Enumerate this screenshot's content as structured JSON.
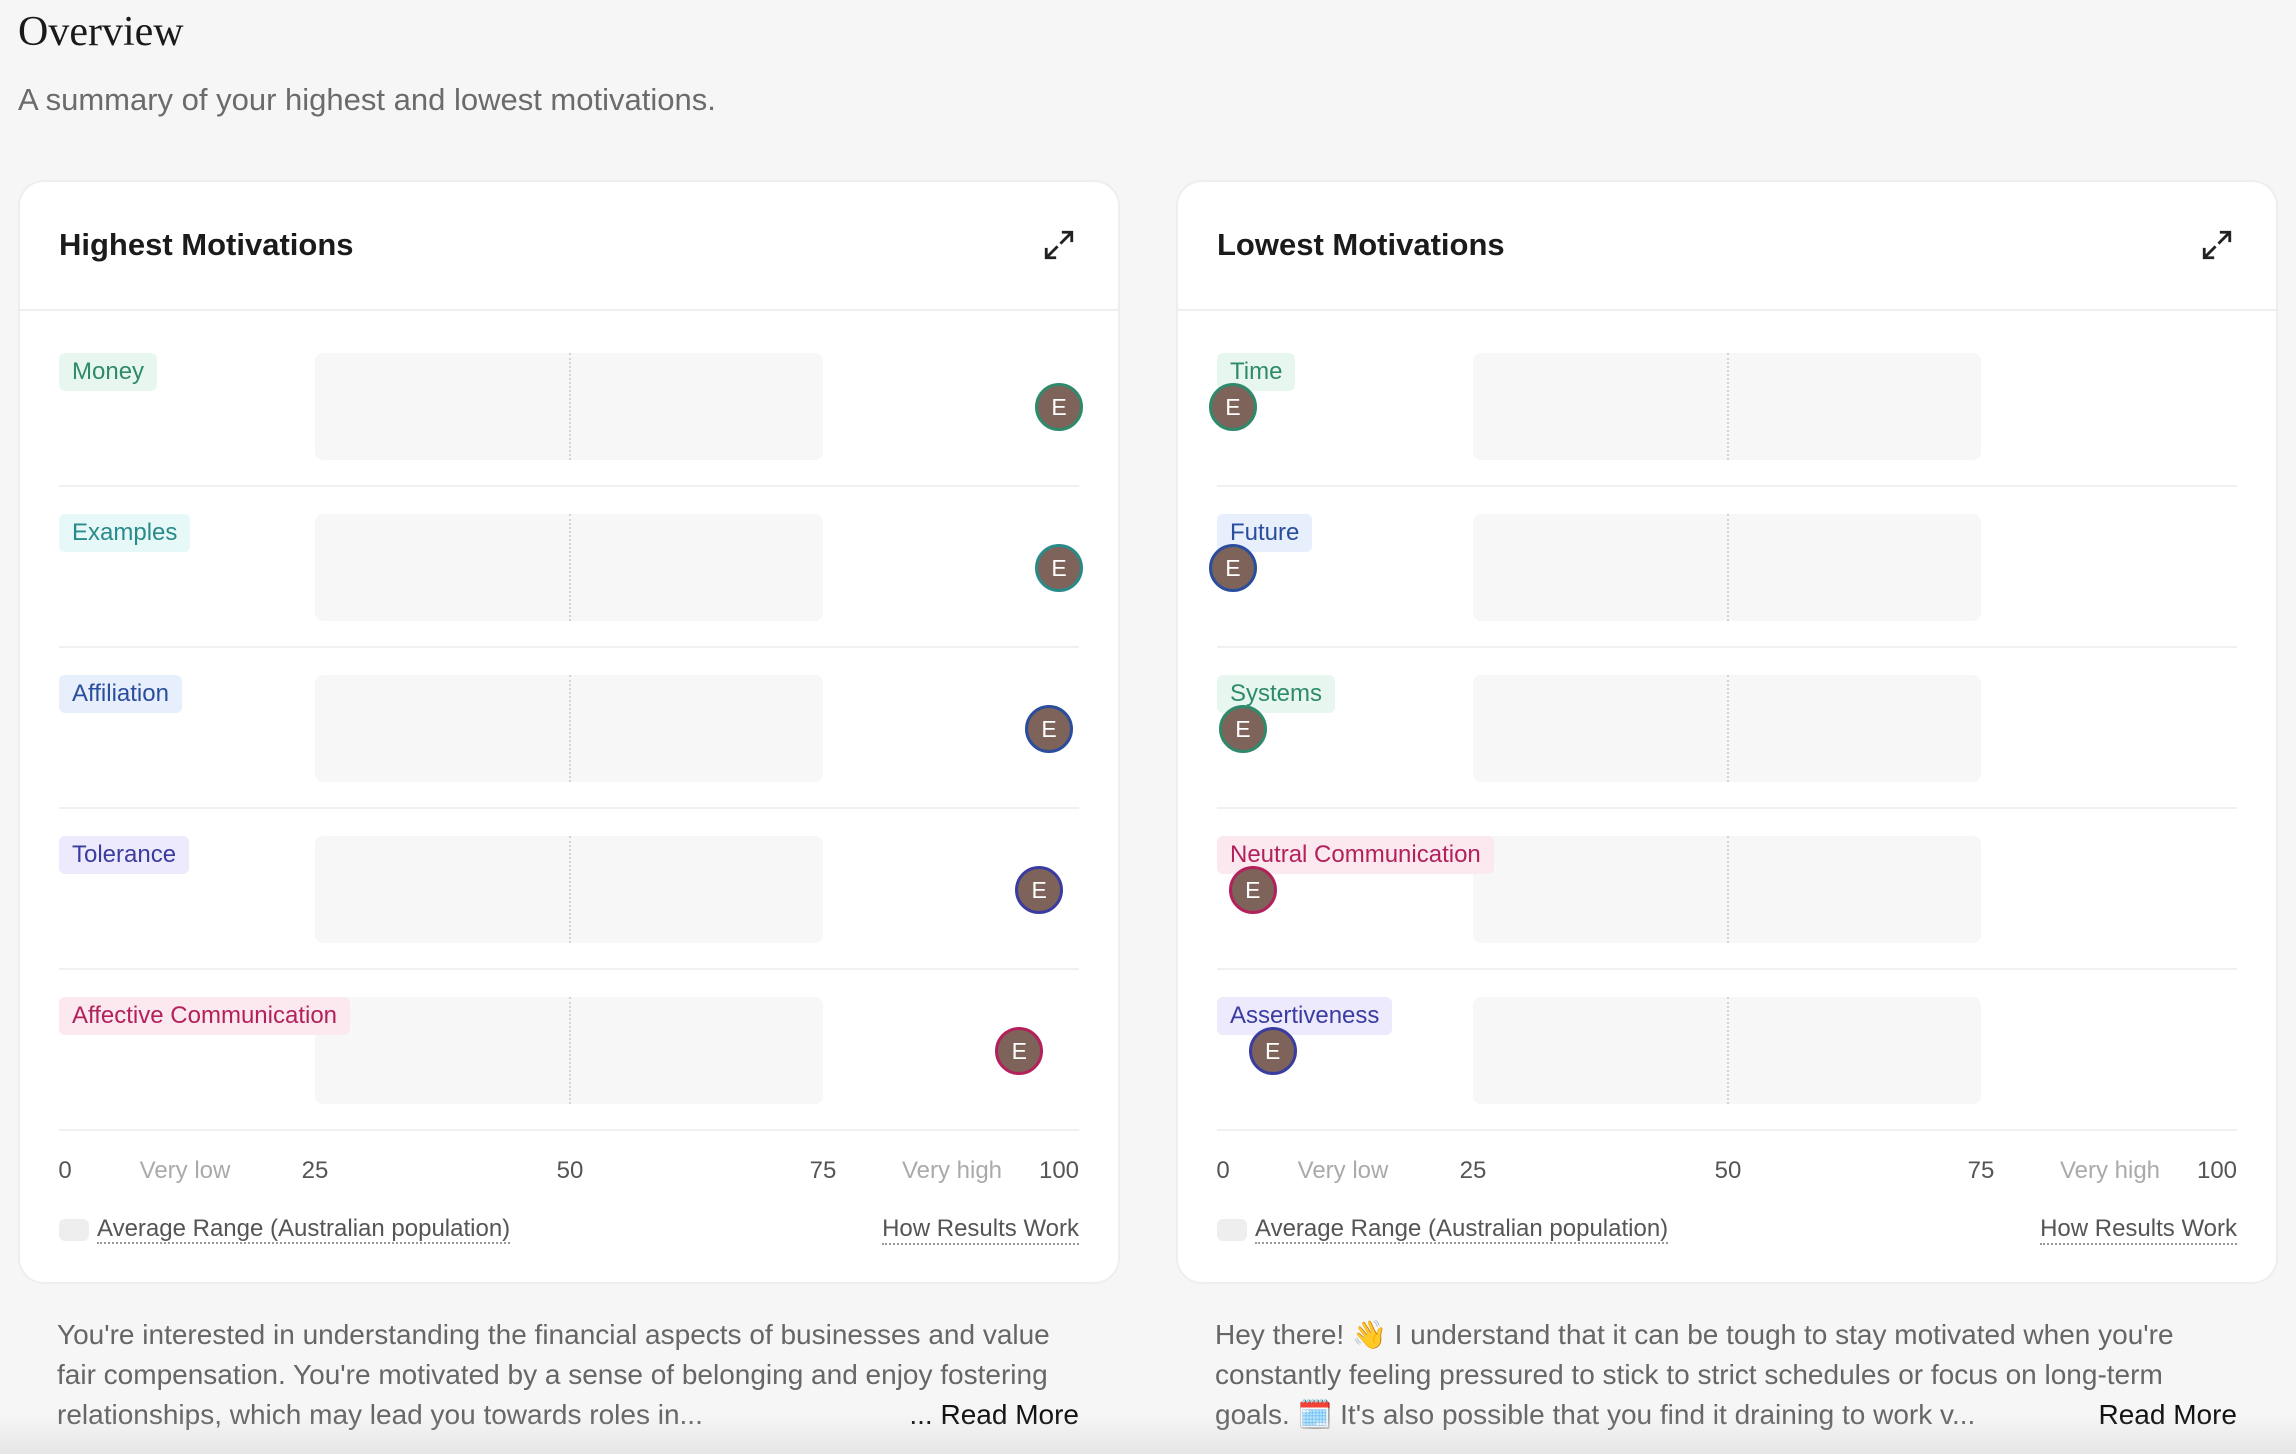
{
  "page": {
    "title": "Overview",
    "subtitle": "A summary of your highest and lowest motivations."
  },
  "axis": {
    "labels": [
      {
        "text": "0",
        "pos": 0
      },
      {
        "text": "Very low",
        "pos": 12.5,
        "weak": true
      },
      {
        "text": "25",
        "pos": 25
      },
      {
        "text": "50",
        "pos": 50
      },
      {
        "text": "75",
        "pos": 75
      },
      {
        "text": "Very high",
        "pos": 87.5,
        "weak": true
      },
      {
        "text": "100",
        "pos": 100
      }
    ]
  },
  "marker_initial": "E",
  "marker_fill": "#7d6359",
  "panels": [
    {
      "title": "Highest Motivations",
      "legend": "Average Range (Australian population)",
      "link": "How Results Work",
      "items": [
        {
          "label": "Money",
          "score": 100,
          "color": "#2f8a6b",
          "bg": "#e7f7f0"
        },
        {
          "label": "Examples",
          "score": 100,
          "color": "#2a8a8a",
          "bg": "#e6f8f7"
        },
        {
          "label": "Affiliation",
          "score": 99,
          "color": "#2a4d9c",
          "bg": "#e7eefc"
        },
        {
          "label": "Tolerance",
          "score": 98,
          "color": "#3b3ca0",
          "bg": "#eceafc"
        },
        {
          "label": "Affective Communication",
          "score": 96,
          "color": "#b3215c",
          "bg": "#fce8ef"
        }
      ],
      "summary": "You're interested in understanding the financial aspects of businesses and value fair compensation. You're motivated by a sense of belonging and enjoy fostering relationships, which may lead you towards roles in...",
      "read_more": "... Read More"
    },
    {
      "title": "Lowest Motivations",
      "legend": "Average Range (Australian population)",
      "link": "How Results Work",
      "items": [
        {
          "label": "Time",
          "score": 1,
          "color": "#2f8a6b",
          "bg": "#e7f7f0"
        },
        {
          "label": "Future",
          "score": 1,
          "color": "#2a4d9c",
          "bg": "#e7eefc"
        },
        {
          "label": "Systems",
          "score": 2,
          "color": "#2f8a6b",
          "bg": "#e7f7f0"
        },
        {
          "label": "Neutral Communication",
          "score": 3,
          "color": "#b3215c",
          "bg": "#fce8ef"
        },
        {
          "label": "Assertiveness",
          "score": 5,
          "color": "#3b3ca0",
          "bg": "#eceafc"
        }
      ],
      "summary": "Hey there! 👋 I understand that it can be tough to stay motivated when you're constantly feeling pressured to stick to strict schedules or focus on long-term goals. 🗓️ It's also possible that you find it draining to work v...",
      "read_more": "Read More"
    }
  ]
}
